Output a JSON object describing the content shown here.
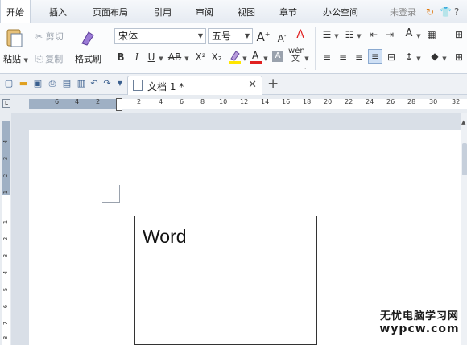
{
  "ribbon_tabs": [
    "开始",
    "插入",
    "页面布局",
    "引用",
    "审阅",
    "视图",
    "章节",
    "办公空间"
  ],
  "user_status": "未登录",
  "clipboard": {
    "paste": "粘贴",
    "cut": "剪切",
    "copy": "复制",
    "format_painter": "格式刷"
  },
  "font": {
    "family": "宋体",
    "size": "五号"
  },
  "text_format_buttons": [
    "B",
    "I",
    "U",
    "AB",
    "X²",
    "X₂"
  ],
  "document_tab": {
    "name": "文档 1 *"
  },
  "ruler": {
    "left_numbers": [
      "6",
      "4",
      "2"
    ],
    "right_numbers": [
      "2",
      "4",
      "6",
      "8",
      "10",
      "12",
      "14",
      "16",
      "18",
      "20",
      "22",
      "24",
      "26",
      "28",
      "30",
      "32"
    ],
    "vertical_numbers": [
      "4",
      "3",
      "2",
      "1",
      "1",
      "2",
      "3",
      "4",
      "5",
      "6",
      "7",
      "8"
    ]
  },
  "document": {
    "textbox_text": "Word"
  },
  "watermark": {
    "line1": "无忧电脑学习网",
    "line2": "wypcw.com"
  },
  "colors": {
    "accent": "#2b579a",
    "highlight_yellow": "#ffe600",
    "font_color_red": "#e02020"
  }
}
